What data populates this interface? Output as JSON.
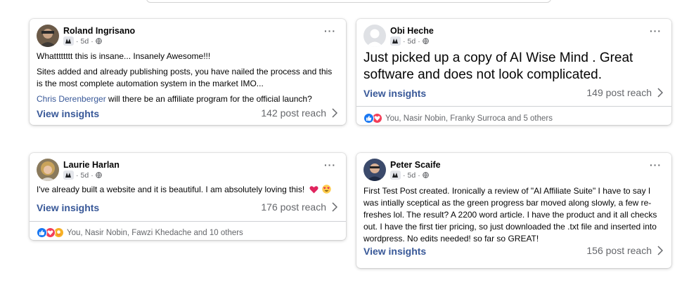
{
  "posts": [
    {
      "author": "Roland Ingrisano",
      "time": "5d",
      "paragraphs": [
        "Whatttttttt this is insane... Insanely Awesome!!!",
        "Sites added and already publishing posts, you have nailed the process and this is the most complete automation system in the market IMO..."
      ],
      "mention": "Chris Derenberger",
      "mention_tail": " will there be an affiliate program for the official launch?",
      "insights_label": "View insights",
      "reach": "142 post reach"
    },
    {
      "author": "Obi Heche",
      "time": "5d",
      "paragraphs": [
        "Just picked up a copy of AI Wise Mind . Great software and does not look complicated."
      ],
      "insights_label": "View insights",
      "reach": "149 post reach",
      "reactions": {
        "icons": [
          "like-icon",
          "love-icon"
        ],
        "text": "You, Nasir Nobin, Franky Surroca and 5 others"
      }
    },
    {
      "author": "Laurie Harlan",
      "time": "5d",
      "paragraphs": [
        "I've already built a website and it is beautiful. I am absolutely loving this!"
      ],
      "emojis": [
        "red-heart-emoji",
        "heart-eyes-emoji"
      ],
      "insights_label": "View insights",
      "reach": "176 post reach",
      "reactions": {
        "icons": [
          "like-icon",
          "love-icon",
          "care-icon"
        ],
        "text": "You, Nasir Nobin, Fawzi Khedache and 10 others"
      }
    },
    {
      "author": "Peter Scaife",
      "time": "5d",
      "paragraphs": [
        "First Test Post created. Ironically a review of \"AI Affiliate Suite\" I have to say I was intially sceptical as the green progress bar moved along slowly, a few re-freshes lol. The result? A 2200 word article. I have the product and it all checks out. I have the first tier pricing, so just downloaded the .txt file and inserted into wordpress. No edits needed! so far so GREAT!"
      ],
      "insights_label": "View insights",
      "reach": "156 post reach"
    }
  ],
  "common": {
    "meta_sep": "·",
    "more_label": "···"
  },
  "colors": {
    "link": "#385898",
    "muted": "#65676b",
    "like": "#1877f2",
    "love": "#f33e58",
    "care": "#f7b125"
  }
}
